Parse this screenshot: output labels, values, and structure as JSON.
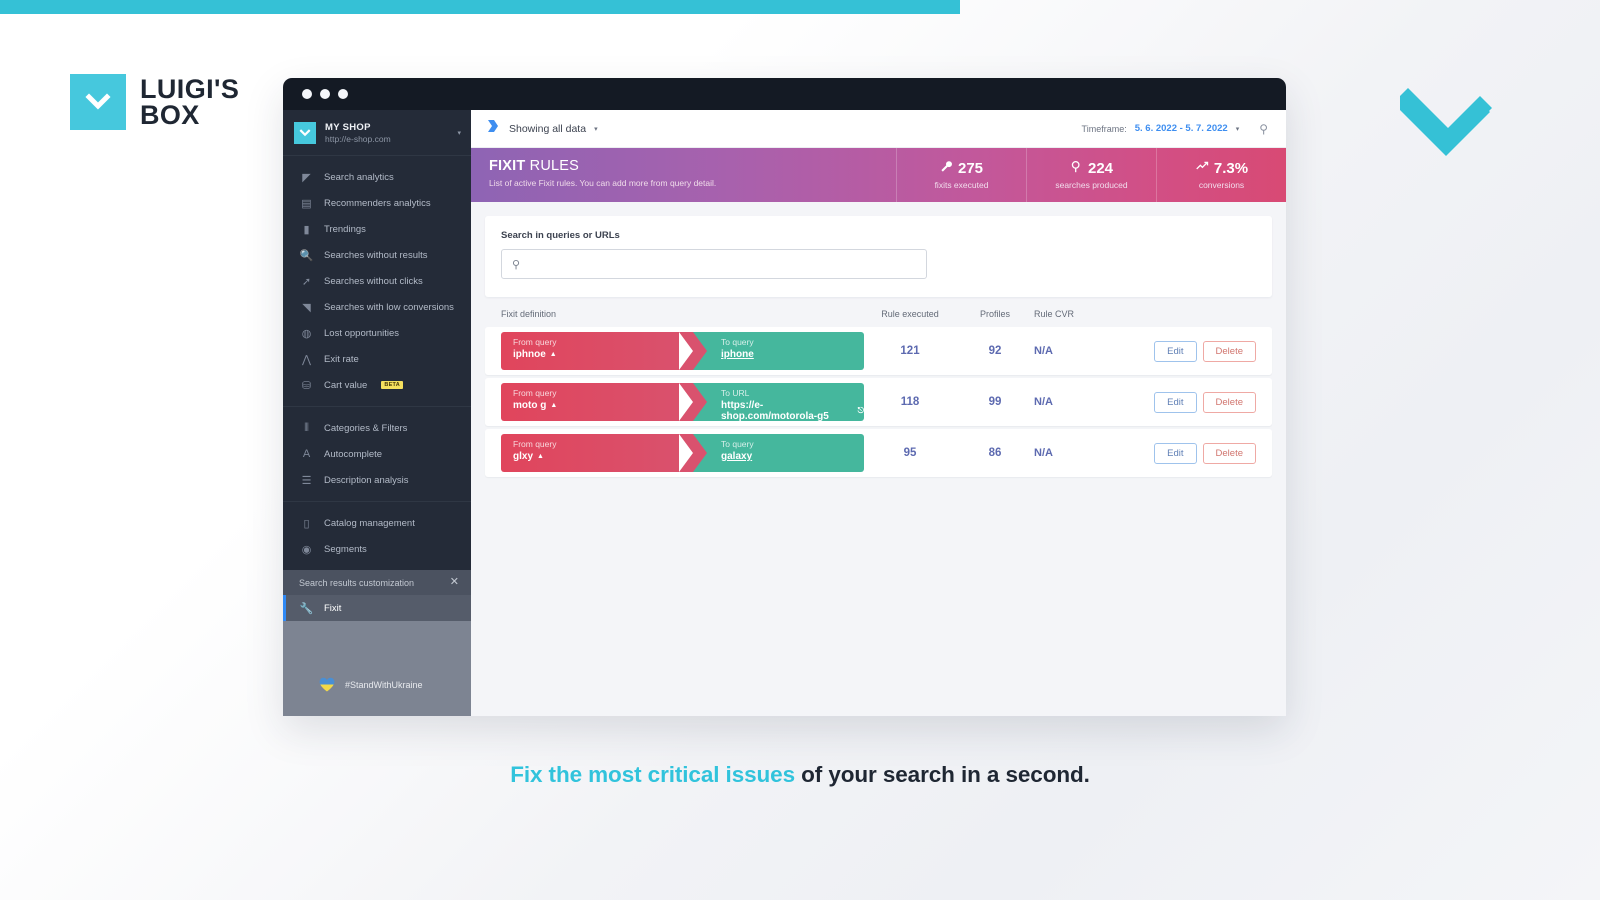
{
  "brand": {
    "name_line1": "LUIGI'S",
    "name_line2": "BOX",
    "mark_icon": "chevron-down-icon",
    "accent": "#46c8dd"
  },
  "window": {
    "traffic_lights": 3
  },
  "sidebar": {
    "shop": {
      "name": "MY SHOP",
      "url": "http://e-shop.com",
      "caret": "▾",
      "logo_icon": "chevron-down-icon"
    },
    "groups": [
      {
        "items": [
          {
            "label": "Search analytics",
            "icon": "megaphone-icon"
          },
          {
            "label": "Recommenders analytics",
            "icon": "list-search-icon"
          },
          {
            "label": "Trendings",
            "icon": "bar-chart-icon"
          },
          {
            "label": "Searches without results",
            "icon": "magnifier-icon"
          },
          {
            "label": "Searches without clicks",
            "icon": "cursor-click-icon"
          },
          {
            "label": "Searches with low conversions",
            "icon": "thumbs-down-icon"
          },
          {
            "label": "Lost opportunities",
            "icon": "money-bag-icon"
          },
          {
            "label": "Exit rate",
            "icon": "road-fork-icon"
          },
          {
            "label": "Cart value",
            "icon": "shopping-basket-icon",
            "badge": "BETA"
          }
        ]
      },
      {
        "items": [
          {
            "label": "Categories & Filters",
            "icon": "sliders-icon"
          },
          {
            "label": "Autocomplete",
            "icon": "text-cursor-icon"
          },
          {
            "label": "Description analysis",
            "icon": "align-left-icon"
          }
        ]
      },
      {
        "items": [
          {
            "label": "Catalog management",
            "icon": "book-icon"
          },
          {
            "label": "Segments",
            "icon": "segment-icon"
          }
        ]
      }
    ],
    "section": {
      "title": "Search results customization",
      "close_icon": "close-icon"
    },
    "active_item": {
      "label": "Fixit",
      "icon": "wrench-icon"
    },
    "footer": {
      "label": "#StandWithUkraine",
      "icon": "ukraine-heart-icon"
    }
  },
  "topbar": {
    "data_scope": "Showing all data",
    "data_scope_icon": "filter-flag-icon",
    "caret": "▾",
    "timeframe_label": "Timeframe:",
    "timeframe_value": "5. 6. 2022 - 5. 7. 2022",
    "timeframe_caret": "▾",
    "search_icon": "search-icon"
  },
  "hero": {
    "title_bold": "FIXIT",
    "title_rest": " RULES",
    "subtitle": "List of active Fixit rules. You can add more from query detail.",
    "kpis": [
      {
        "value": "275",
        "label": "fixits executed",
        "icon": "wrench-icon"
      },
      {
        "value": "224",
        "label": "searches produced",
        "icon": "magnifier-icon"
      },
      {
        "value": "7.3%",
        "label": "conversions",
        "icon": "trend-up-icon"
      }
    ]
  },
  "search_card": {
    "label": "Search in queries or URLs",
    "icon": "search-icon",
    "value": "",
    "placeholder": ""
  },
  "table": {
    "headers": {
      "definition": "Fixit definition",
      "rule_executed": "Rule executed",
      "profiles": "Profiles",
      "rule_cvr": "Rule CVR"
    },
    "actions": {
      "edit": "Edit",
      "delete": "Delete"
    },
    "rows": [
      {
        "from_caption": "From query",
        "from_value": "iphnoe",
        "from_arrow": "▲",
        "to_caption": "To query",
        "to_value": "iphone",
        "to_external": false,
        "rule_executed": "121",
        "profiles": "92",
        "rule_cvr": "N/A"
      },
      {
        "from_caption": "From query",
        "from_value": "moto g",
        "from_arrow": "▲",
        "to_caption": "To URL",
        "to_value": "https://e-shop.com/motorola-g5",
        "to_external": true,
        "rule_executed": "118",
        "profiles": "99",
        "rule_cvr": "N/A"
      },
      {
        "from_caption": "From query",
        "from_value": "glxy",
        "from_arrow": "▲",
        "to_caption": "To query",
        "to_value": "galaxy",
        "to_external": false,
        "rule_executed": "95",
        "profiles": "86",
        "rule_cvr": "N/A"
      }
    ]
  },
  "tagline": {
    "highlight": "Fix the most critical issues",
    "rest": " of your search in a second.",
    "highlight_color": "#31c3dc"
  }
}
